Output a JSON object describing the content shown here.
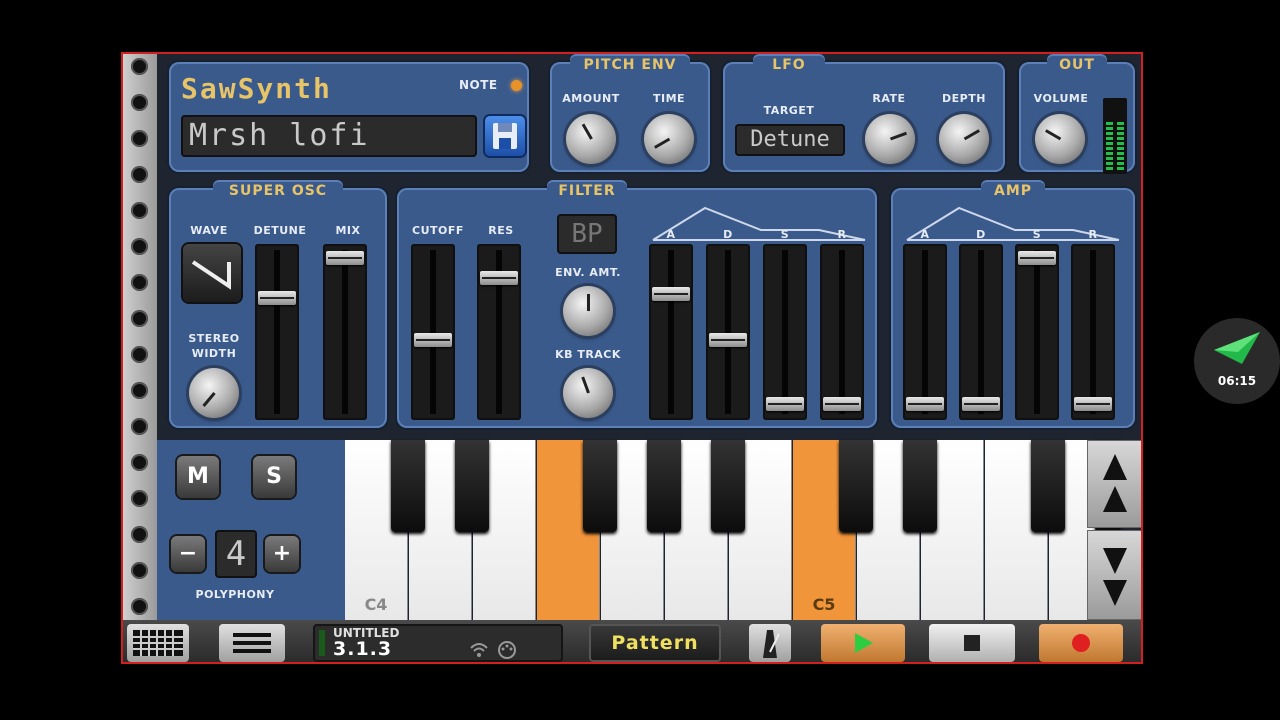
{
  "synth": {
    "title": "SawSynth",
    "note_label": "NOTE",
    "preset_name": "Mrsh lofi"
  },
  "pitch_env": {
    "title": "PITCH ENV",
    "amount_label": "AMOUNT",
    "time_label": "TIME"
  },
  "lfo": {
    "title": "LFO",
    "target_label": "TARGET",
    "target_value": "Detune",
    "rate_label": "RATE",
    "depth_label": "DEPTH"
  },
  "out": {
    "title": "OUT",
    "volume_label": "VOLUME"
  },
  "super_osc": {
    "title": "SUPER OSC",
    "wave_label": "WAVE",
    "detune_label": "DETUNE",
    "mix_label": "MIX",
    "stereo_label_1": "STEREO",
    "stereo_label_2": "WIDTH",
    "detune_level": 0.72,
    "mix_level": 0.98
  },
  "filter": {
    "title": "FILTER",
    "cutoff_label": "CUTOFF",
    "res_label": "RES",
    "mode": "BP",
    "env_amt_label": "ENV. AMT.",
    "kb_track_label": "KB TRACK",
    "cutoff_level": 0.45,
    "res_level": 0.85,
    "env_labels": [
      "A",
      "D",
      "S",
      "R"
    ],
    "env_levels": [
      0.75,
      0.45,
      0.03,
      0.03
    ]
  },
  "amp": {
    "title": "AMP",
    "env_labels": [
      "A",
      "D",
      "S",
      "R"
    ],
    "env_levels": [
      0.03,
      0.03,
      0.98,
      0.03
    ]
  },
  "keyboard": {
    "mute_label": "M",
    "solo_label": "S",
    "minus_label": "−",
    "plus_label": "+",
    "polyphony_value": "4",
    "polyphony_label": "POLYPHONY",
    "c4_label": "C4",
    "c5_label": "C5"
  },
  "transport": {
    "song_title": "UNTITLED",
    "position": "3.1.3",
    "pattern_label": "Pattern"
  },
  "overlay": {
    "time": "06:15"
  },
  "colors": {
    "panel": "#3a5a8c",
    "accent": "#e8c468",
    "key_active": "#f0953a",
    "record": "#e02020",
    "play": "#2ecc40"
  }
}
